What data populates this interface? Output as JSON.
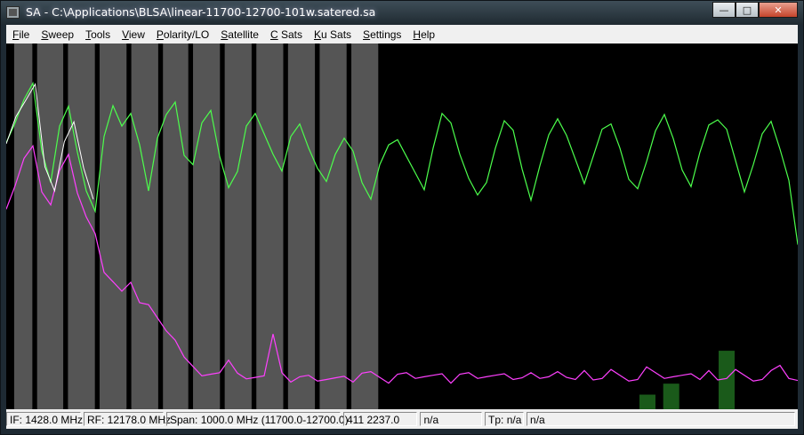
{
  "window": {
    "title": "SA - C:\\Applications\\BLSA\\linear-11700-12700-101w.satered.sa",
    "buttons": {
      "minimize": "—",
      "maximize": "□",
      "close": "✕"
    }
  },
  "menu": [
    {
      "accel": "F",
      "rest": "ile"
    },
    {
      "accel": "S",
      "rest": "weep"
    },
    {
      "accel": "T",
      "rest": "ools"
    },
    {
      "accel": "V",
      "rest": "iew"
    },
    {
      "accel": "P",
      "rest": "olarity/LO"
    },
    {
      "accel": "S",
      "rest": "atellite"
    },
    {
      "accel": "C",
      "rest": " Sats"
    },
    {
      "accel": "K",
      "rest": "u Sats"
    },
    {
      "accel": "S",
      "rest": "ettings"
    },
    {
      "accel": "H",
      "rest": "elp"
    }
  ],
  "status": {
    "if": "IF: 1428.0 MHz",
    "rf": "RF: 12178.0 MHz",
    "span": "Span: 1000.0 MHz (11700.0-12700.0)",
    "level": "411 2237.0",
    "field4": "n/a",
    "tp": "Tp: n/a",
    "field6": "n/a"
  },
  "colors": {
    "trace_green": "#4cff4c",
    "trace_magenta": "#ff40ff",
    "trace_white": "#ffffff",
    "band_gray": "#555555",
    "bar_green": "#1a5a1a"
  },
  "chart_data": {
    "type": "line",
    "series": [
      {
        "values": [
          0.72,
          0.78,
          0.85,
          0.9,
          0.7,
          0.62,
          0.78,
          0.82,
          0.7,
          0.6,
          0.55,
          0.74,
          0.83,
          0.78,
          0.8,
          0.72,
          0.6,
          0.75,
          0.8,
          0.84,
          0.7,
          0.66,
          0.78,
          0.82,
          0.7,
          0.6,
          0.65,
          0.78,
          0.8,
          0.75,
          0.7,
          0.66,
          0.74,
          0.78,
          0.72,
          0.65,
          0.62,
          0.7,
          0.75,
          0.7,
          0.62,
          0.58,
          0.66,
          0.72,
          0.74,
          0.7,
          0.64,
          0.6,
          0.72,
          0.8,
          0.78,
          0.7,
          0.64,
          0.58,
          0.62,
          0.72,
          0.78,
          0.76,
          0.66,
          0.58,
          0.66,
          0.75,
          0.8,
          0.74,
          0.68,
          0.62,
          0.7,
          0.76,
          0.78,
          0.72,
          0.62,
          0.6,
          0.68,
          0.77,
          0.8,
          0.74,
          0.66,
          0.6,
          0.7,
          0.78,
          0.8,
          0.76,
          0.68,
          0.6,
          0.66,
          0.75,
          0.79,
          0.72,
          0.62,
          0.45
        ]
      },
      {
        "values": [
          0.55,
          0.62,
          0.68,
          0.72,
          0.6,
          0.55,
          0.65,
          0.7,
          0.6,
          0.52,
          0.48,
          0.38,
          0.34,
          0.32,
          0.35,
          0.3,
          0.28,
          0.25,
          0.22,
          0.18,
          0.14,
          0.12,
          0.1,
          0.09,
          0.1,
          0.14,
          0.09,
          0.08,
          0.09,
          0.1,
          0.2,
          0.1,
          0.08,
          0.08,
          0.09,
          0.08,
          0.09,
          0.08,
          0.09,
          0.08,
          0.09,
          0.1,
          0.09,
          0.08,
          0.09,
          0.1,
          0.09,
          0.08,
          0.09,
          0.1,
          0.08,
          0.09,
          0.1,
          0.09,
          0.08,
          0.09,
          0.1,
          0.09,
          0.08,
          0.1,
          0.09,
          0.08,
          0.1,
          0.09,
          0.09,
          0.1,
          0.08,
          0.09,
          0.1,
          0.09,
          0.08,
          0.09,
          0.11,
          0.1,
          0.09,
          0.08,
          0.09,
          0.1,
          0.09,
          0.1,
          0.08,
          0.09,
          0.1,
          0.09,
          0.08,
          0.09,
          0.1,
          0.12,
          0.09,
          0.07
        ]
      },
      {
        "values": [
          0.72,
          0.8,
          0.85,
          0.88,
          0.66,
          0.6,
          0.74,
          0.78,
          0.66,
          0.58
        ]
      }
    ],
    "bands": [
      {
        "start": 0.01,
        "end": 0.033
      },
      {
        "start": 0.039,
        "end": 0.072
      },
      {
        "start": 0.078,
        "end": 0.112
      },
      {
        "start": 0.118,
        "end": 0.152
      },
      {
        "start": 0.158,
        "end": 0.192
      },
      {
        "start": 0.198,
        "end": 0.23
      },
      {
        "start": 0.236,
        "end": 0.27
      },
      {
        "start": 0.276,
        "end": 0.31
      },
      {
        "start": 0.316,
        "end": 0.35
      },
      {
        "start": 0.356,
        "end": 0.39
      },
      {
        "start": 0.396,
        "end": 0.43
      },
      {
        "start": 0.436,
        "end": 0.47
      }
    ],
    "bars": [
      {
        "x": 0.8,
        "value": 0.02
      },
      {
        "x": 0.83,
        "value": 0.035
      },
      {
        "x": 0.9,
        "value": 0.08
      }
    ],
    "ylim": [
      0,
      1
    ]
  }
}
